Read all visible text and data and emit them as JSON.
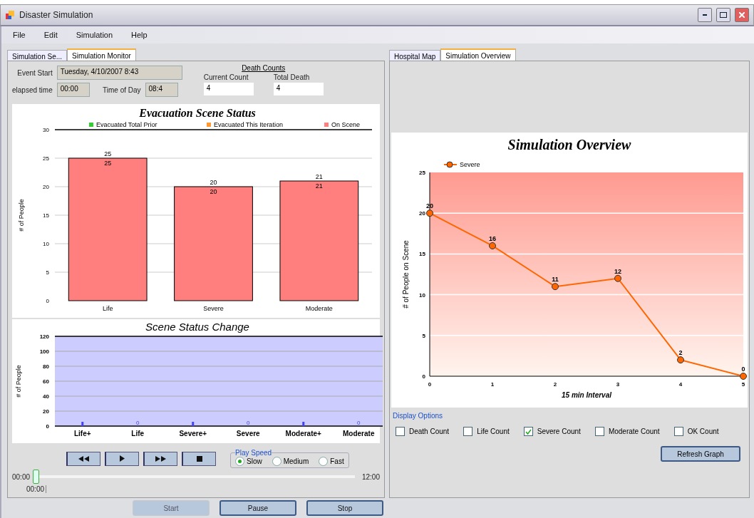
{
  "window": {
    "title": "Disaster Simulation"
  },
  "menu": [
    {
      "label": "File"
    },
    {
      "label": "Edit"
    },
    {
      "label": "Simulation"
    },
    {
      "label": "Help"
    }
  ],
  "left_tabs": [
    {
      "label": "Simulation Se...",
      "selected": false
    },
    {
      "label": "Simulation Monitor",
      "selected": true
    }
  ],
  "fields": [
    {
      "label": "Event Start",
      "value": "Tuesday, 4/10/2007 8:43"
    },
    {
      "label": "elapsed time",
      "value": "00:00"
    },
    {
      "label": "Time of Day",
      "value": "08:4"
    }
  ],
  "death_counts": {
    "heading": "Death Counts",
    "fields": [
      {
        "label": "Current Count",
        "value": "4"
      },
      {
        "label": "Total Death",
        "value": "4"
      }
    ]
  },
  "scene_status": {
    "chart_data": {
      "type": "bar",
      "title": "Evacuation Scene Status",
      "ylabel": "# of People",
      "categories": [
        "Life",
        "Severe",
        "Moderate"
      ],
      "stacked": true,
      "grid": true,
      "ylim": [
        0,
        30
      ],
      "yticks": [
        0,
        5,
        10,
        15,
        20,
        25,
        30
      ],
      "series": [
        {
          "name": "Evacuated Total Prior",
          "color": "#33cc33",
          "values": [
            0,
            0,
            0
          ],
          "value_labels": [
            null,
            null,
            null
          ]
        },
        {
          "name": "Evacuated This Iteration",
          "color": "#ff9933",
          "values": [
            0,
            0,
            0
          ],
          "value_labels": [
            null,
            null,
            null
          ]
        },
        {
          "name": "On Scene",
          "color": "#ff7f7f",
          "values": [
            25,
            20,
            21
          ],
          "value_labels": [
            "25",
            "20",
            "21"
          ]
        }
      ],
      "annotations": [
        {
          "text": "25",
          "x": "Life",
          "y": 25
        },
        {
          "text": "20",
          "x": "Severe",
          "y": 20
        },
        {
          "text": "21",
          "x": "Moderate",
          "y": 21
        }
      ]
    }
  },
  "status_change": {
    "chart_data": {
      "type": "bar",
      "title": "Scene Status Change",
      "ylabel": "# of People",
      "categories": [
        "Life+",
        "Life",
        "Severe+",
        "Severe",
        "Moderate+",
        "Moderate"
      ],
      "grid": true,
      "ylim": [
        0,
        120
      ],
      "yticks": [
        0,
        20,
        40,
        60,
        80,
        100,
        120
      ],
      "series": [
        {
          "color": "#4444ee",
          "values": [
            0,
            0,
            0,
            0,
            0,
            0
          ],
          "value_labels": [
            null,
            "0",
            null,
            "0",
            null,
            "0"
          ]
        }
      ]
    }
  },
  "playback": {
    "buttons": [
      {
        "kind": "rewind"
      },
      {
        "kind": "play"
      },
      {
        "kind": "forward"
      },
      {
        "kind": "stop"
      }
    ],
    "speed": {
      "label": "Play Speed",
      "options": [
        {
          "label": "Slow",
          "selected": true
        },
        {
          "label": "Medium",
          "selected": false
        },
        {
          "label": "Fast",
          "selected": false
        }
      ]
    },
    "slider": {
      "start": "00:00",
      "end": "12:00",
      "level": 0,
      "tick_label": "00:00"
    }
  },
  "right_tabs": [
    {
      "label": "Hospital Map",
      "selected": false
    },
    {
      "label": "Simulation Overview",
      "selected": true
    }
  ],
  "overview": {
    "chart_data": {
      "type": "line",
      "title": "Simulation Overview",
      "xlabel": "15 min Interval",
      "ylabel": "# of People on Scene",
      "x": [
        0,
        1,
        2,
        3,
        4,
        5
      ],
      "xlim": [
        0,
        5
      ],
      "xticks": [
        0,
        1,
        2,
        3,
        4,
        5
      ],
      "ylim": [
        0,
        25
      ],
      "yticks": [
        0,
        5,
        10,
        15,
        20,
        25
      ],
      "data_labels": true,
      "grid": true,
      "series": [
        {
          "name": "Severe",
          "color": "#ff6600",
          "marker": "circle",
          "values": [
            20,
            16,
            11,
            12,
            2,
            0
          ]
        }
      ]
    }
  },
  "display_options": {
    "label": "Display Options",
    "checkboxes": [
      {
        "label": "Death Count",
        "checked": false
      },
      {
        "label": "Life Count",
        "checked": false
      },
      {
        "label": "Severe Count",
        "checked": true
      },
      {
        "label": "Moderate Count",
        "checked": false
      },
      {
        "label": "OK Count",
        "checked": false
      }
    ]
  },
  "refresh_button": {
    "label": "Refresh Graph"
  },
  "bottom_buttons": [
    {
      "label": "Start",
      "disabled": true
    },
    {
      "label": "Pause",
      "disabled": false
    },
    {
      "label": "Stop",
      "disabled": false
    }
  ]
}
